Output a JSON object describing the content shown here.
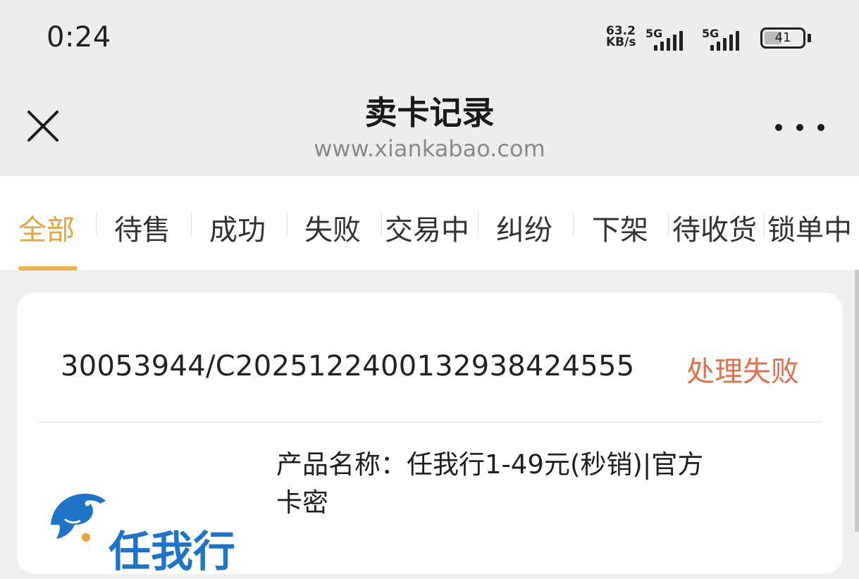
{
  "status_bar": {
    "time": "0:24",
    "network_speed_value": "63.2",
    "network_speed_unit": "KB/s",
    "signal_1_label": "5G",
    "signal_2_label": "5G",
    "battery_level": "41"
  },
  "nav": {
    "title": "卖卡记录",
    "url": "www.xiankabao.com"
  },
  "tabs": [
    {
      "label": "全部",
      "active": true
    },
    {
      "label": "待售"
    },
    {
      "label": "成功"
    },
    {
      "label": "失败"
    },
    {
      "label": "交易中"
    },
    {
      "label": "纠纷"
    },
    {
      "label": "下架"
    },
    {
      "label": "待收货"
    },
    {
      "label": "锁单中"
    }
  ],
  "order": {
    "order_no": "30053944/C2025122400132938424555",
    "status": "处理失败",
    "product_name_line1": "产品名称：任我行1-49元(秒销)|官方",
    "product_name_line2": "卡密",
    "logo_text": "任我行"
  },
  "colors": {
    "accent": "#e7a43d",
    "status_failed": "#e36f4b",
    "logo_blue": "#1d74c9"
  }
}
